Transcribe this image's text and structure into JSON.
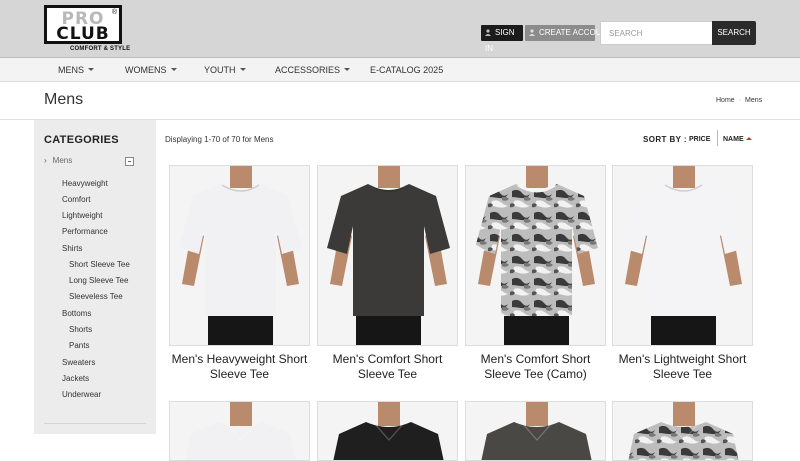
{
  "brand": {
    "top": "PRO",
    "bottom": "CLUB",
    "mark": "®",
    "tagline": "COMFORT & STYLE"
  },
  "header": {
    "signin_label": "SIGN IN",
    "create_label": "CREATE ACCOUNT",
    "search_placeholder": "SEARCH",
    "search_button": "SEARCH"
  },
  "nav": {
    "items": [
      "MENS",
      "WOMENS",
      "YOUTH",
      "ACCESSORIES",
      "E-CATALOG 2025"
    ]
  },
  "page": {
    "title": "Mens",
    "breadcrumb": [
      "Home",
      "Mens"
    ]
  },
  "sidebar": {
    "title": "CATEGORIES",
    "current": "Mens",
    "items": [
      "Heavyweight",
      "Comfort",
      "Lightweight",
      "Performance",
      "Shirts",
      "Short Sleeve Tee",
      "Long Sleeve Tee",
      "Sleeveless Tee",
      "Bottoms",
      "Shorts",
      "Pants",
      "Sweaters",
      "Jackets",
      "Underwear"
    ]
  },
  "listing": {
    "count_text": "Displaying 1-70 of 70 for Mens",
    "sort_label": "SORT BY :",
    "sort_price": "PRICE",
    "sort_name": "NAME"
  },
  "products": [
    {
      "name_line1": "Men's Heavyweight Short",
      "name_line2": "Sleeve Tee",
      "shirt_color": "#f1f1f3",
      "style": "plain"
    },
    {
      "name_line1": "Men's Comfort Short",
      "name_line2": "Sleeve Tee",
      "shirt_color": "#3b3a38",
      "style": "plain"
    },
    {
      "name_line1": "Men's Comfort Short",
      "name_line2": "Sleeve Tee (Camo)",
      "shirt_color": "#9a9a9a",
      "style": "camo"
    },
    {
      "name_line1": "Men's Lightweight Short",
      "name_line2": "Sleeve Tee",
      "shirt_color": "#f4f4f6",
      "style": "plain"
    }
  ],
  "products_row2": [
    {
      "shirt_color": "#f1f1f3",
      "style": "plain"
    },
    {
      "shirt_color": "#1f1f1f",
      "style": "plain"
    },
    {
      "shirt_color": "#4a4845",
      "style": "plain"
    },
    {
      "shirt_color": "#9a9a9a",
      "style": "camo"
    }
  ],
  "colors": {
    "skin": "#b98a6c",
    "pants": "#161616",
    "accent": "#c0392b"
  }
}
